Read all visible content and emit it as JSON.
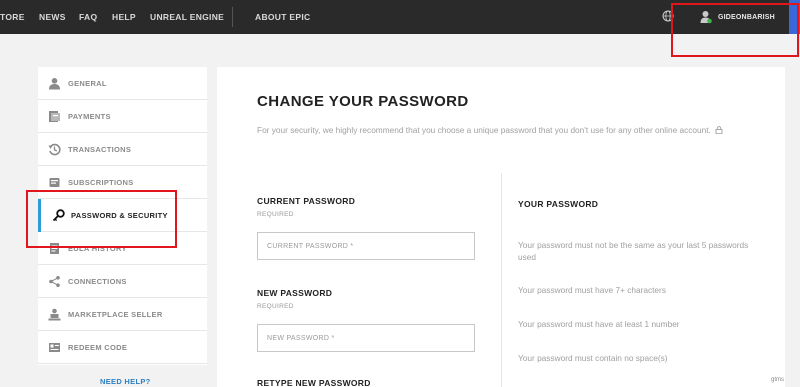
{
  "topnav": {
    "items": [
      "TORE",
      "NEWS",
      "FAQ",
      "HELP",
      "UNREAL ENGINE",
      "ABOUT EPIC"
    ],
    "username": "GIDEONBARISH"
  },
  "sidebar": {
    "items": [
      {
        "label": "GENERAL",
        "icon": "user-icon"
      },
      {
        "label": "PAYMENTS",
        "icon": "payments-icon"
      },
      {
        "label": "TRANSACTIONS",
        "icon": "history-icon"
      },
      {
        "label": "SUBSCRIPTIONS",
        "icon": "subscriptions-icon"
      },
      {
        "label": "PASSWORD & SECURITY",
        "icon": "key-icon",
        "active": true
      },
      {
        "label": "EULA HISTORY",
        "icon": "document-icon"
      },
      {
        "label": "CONNECTIONS",
        "icon": "share-icon"
      },
      {
        "label": "MARKETPLACE SELLER",
        "icon": "seller-icon"
      },
      {
        "label": "REDEEM CODE",
        "icon": "redeem-icon"
      }
    ],
    "need_help": "NEED HELP?"
  },
  "main": {
    "title": "CHANGE YOUR PASSWORD",
    "intro": "For your security, we highly recommend that you choose a unique password that you don't use for any other online account.",
    "fields": [
      {
        "title": "CURRENT PASSWORD",
        "required": "REQUIRED",
        "placeholder": "CURRENT PASSWORD *"
      },
      {
        "title": "NEW PASSWORD",
        "required": "REQUIRED",
        "placeholder": "NEW PASSWORD *"
      },
      {
        "title": "RETYPE NEW PASSWORD"
      }
    ],
    "rules": {
      "title": "YOUR PASSWORD",
      "items": [
        "Your password must not be the same as your last 5 passwords used",
        "Your password must have 7+ characters",
        "Your password must have at least 1 number",
        "Your password must contain no space(s)"
      ]
    }
  },
  "watermark": "gtms",
  "colors": {
    "topbar": "#2a2a2a",
    "active_accent": "#2d9bd6",
    "highlight_box": "#e0161c",
    "link": "#2d7fc0"
  }
}
